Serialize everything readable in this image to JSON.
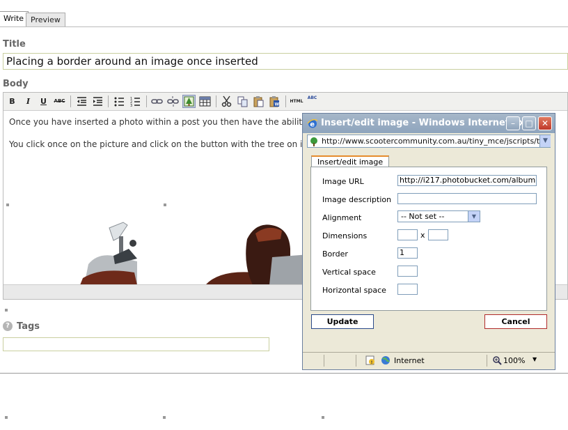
{
  "tabs": [
    {
      "label": "Write"
    },
    {
      "label": "Preview"
    }
  ],
  "form": {
    "title_label": "Title",
    "title_value": "Placing a border around an image once inserted",
    "body_label": "Body",
    "tags_label": "Tags",
    "tags_value": ""
  },
  "toolbar": {
    "bold": "B",
    "italic": "I",
    "underline": "U",
    "strike": "ABC",
    "html": "HTML",
    "spell": "ABC"
  },
  "editor": {
    "paragraph1": "Once you have inserted a photo within a post you then have the ability to",
    "paragraph2": "You click once on the picture and click on the button with the tree on it(in"
  },
  "dialog": {
    "window_title": "Insert/edit image - Windows Internet Ex...",
    "address": "http://www.scootercommunity.com.au/tiny_mce/jscripts/tiny_mc",
    "tab_label": "Insert/edit image",
    "image_url_label": "Image URL",
    "image_url_value": "http://i217.photobucket.com/album",
    "image_description_label": "Image description",
    "image_description_value": "",
    "alignment_label": "Alignment",
    "alignment_value": "-- Not set --",
    "dimensions_label": "Dimensions",
    "dimensions_separator": "x",
    "border_label": "Border",
    "border_value": "1",
    "vertical_space_label": "Vertical space",
    "horizontal_space_label": "Horizontal space",
    "update_button": "Update",
    "cancel_button": "Cancel",
    "zone_label": "Internet",
    "zoom_label": "100%"
  }
}
